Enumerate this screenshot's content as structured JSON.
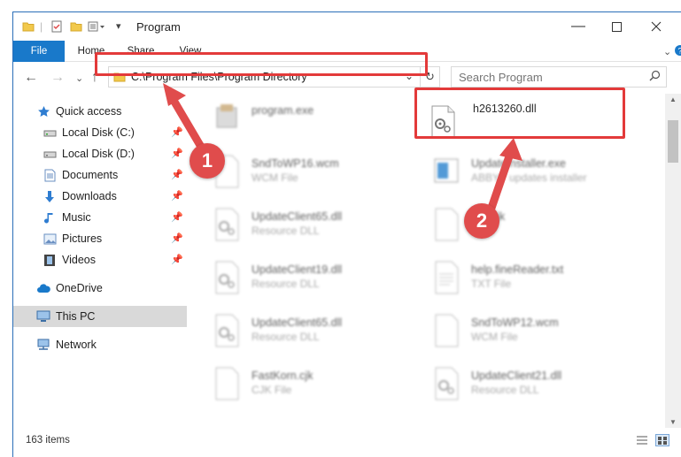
{
  "window": {
    "title": "Program"
  },
  "ribbon": {
    "tabs": [
      {
        "label": "File"
      },
      {
        "label": "Home"
      },
      {
        "label": "Share"
      },
      {
        "label": "View"
      }
    ]
  },
  "address": {
    "path": "C:\\Program Files\\Program Directory"
  },
  "search": {
    "placeholder": "Search Program"
  },
  "sidebar": {
    "items": [
      {
        "label": "Quick access",
        "icon": "star-icon"
      },
      {
        "label": "Local Disk (C:)",
        "icon": "drive-icon",
        "pinned": true
      },
      {
        "label": "Local Disk (D:)",
        "icon": "drive-icon",
        "pinned": true
      },
      {
        "label": "Documents",
        "icon": "documents-icon",
        "pinned": true
      },
      {
        "label": "Downloads",
        "icon": "download-icon",
        "pinned": true
      },
      {
        "label": "Music",
        "icon": "music-icon",
        "pinned": true
      },
      {
        "label": "Pictures",
        "icon": "pictures-icon",
        "pinned": true
      },
      {
        "label": "Videos",
        "icon": "videos-icon",
        "pinned": true
      },
      {
        "label": "OneDrive",
        "icon": "cloud-icon"
      },
      {
        "label": "This PC",
        "icon": "computer-icon",
        "selected": true
      },
      {
        "label": "Network",
        "icon": "network-icon"
      }
    ]
  },
  "files": {
    "left": [
      {
        "name": "program.exe",
        "type": ""
      },
      {
        "name": "SndToWP16.wcm",
        "type": "WCM File"
      },
      {
        "name": "UpdateClient65.dll",
        "type": "Resource DLL"
      },
      {
        "name": "UpdateClient19.dll",
        "type": "Resource DLL"
      },
      {
        "name": "UpdateClient65.dll",
        "type": "Resource DLL"
      },
      {
        "name": "FastKorn.cjk",
        "type": "CJK File"
      }
    ],
    "right": [
      {
        "name": "h2613260.dll",
        "type": ""
      },
      {
        "name": "UpdateInstaller.exe",
        "type": "ABBYY updates installer"
      },
      {
        "name": "xml.cjk",
        "type": "File"
      },
      {
        "name": "help.fineReader.txt",
        "type": "TXT File"
      },
      {
        "name": "SndToWP12.wcm",
        "type": "WCM File"
      },
      {
        "name": "UpdateClient21.dll",
        "type": "Resource DLL"
      }
    ]
  },
  "status": {
    "count": "163 items"
  },
  "annotations": {
    "badge1": "1",
    "badge2": "2"
  },
  "colors": {
    "accent": "#1979ca",
    "highlight": "#e33a3a",
    "badge": "#e04c4c"
  }
}
